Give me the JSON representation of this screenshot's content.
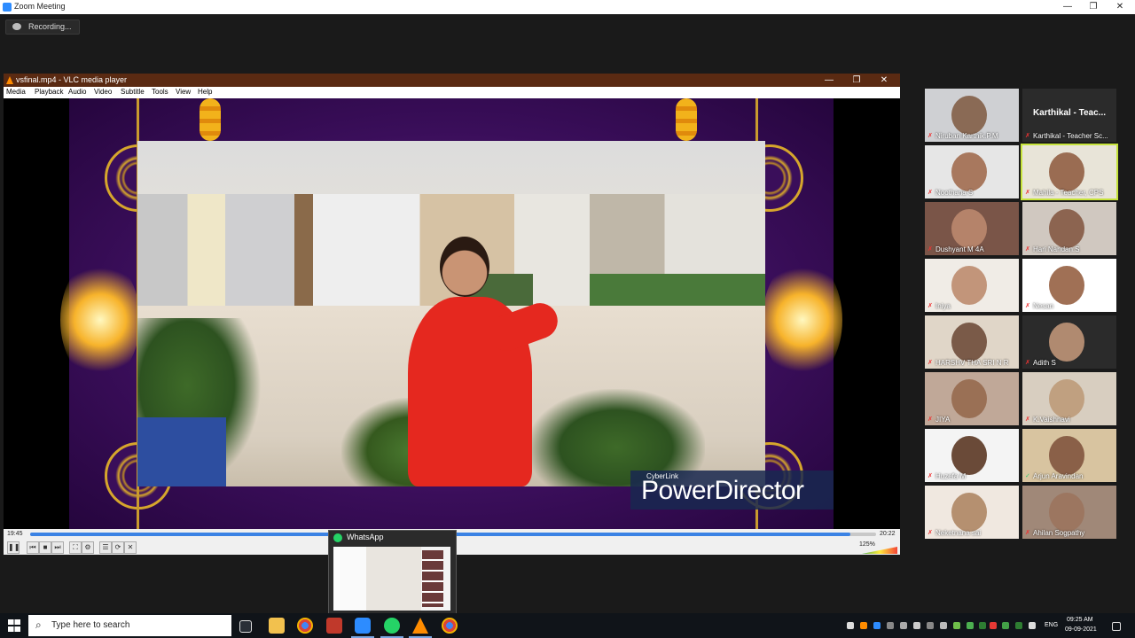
{
  "zoom": {
    "title": "Zoom Meeting",
    "recording_label": "Recording..."
  },
  "vlc": {
    "title": "vsfinal.mp4 - VLC media player",
    "menu": [
      "Media",
      "Playback",
      "Audio",
      "Video",
      "Subtitle",
      "Tools",
      "View",
      "Help"
    ],
    "elapsed": "19:45",
    "total": "20:22",
    "progress": 0.97,
    "volume_label": "125%",
    "watermark_small": "CyberLink",
    "watermark_big": "PowerDirector"
  },
  "participants": [
    {
      "name": "Niruban Karthik.P.M",
      "muted": true
    },
    {
      "name": "Karthikal - Teacher Sc...",
      "muted": true,
      "display_name": "Karthikal - Teac..."
    },
    {
      "name": "Noothana S",
      "muted": true
    },
    {
      "name": "Mahila - Teacher, CPS",
      "muted": true,
      "active_speaker": true
    },
    {
      "name": "Dushyant M 4A",
      "muted": true
    },
    {
      "name": "Hari Nandan.S",
      "muted": true
    },
    {
      "name": "Iniya",
      "muted": true
    },
    {
      "name": "Nesan",
      "muted": true
    },
    {
      "name": "HARSHV THA SRI N R",
      "muted": true
    },
    {
      "name": "Adith S",
      "muted": true
    },
    {
      "name": "JIYA",
      "muted": true
    },
    {
      "name": "K.Vaishnavi",
      "muted": true
    },
    {
      "name": "Huzefa M",
      "muted": true
    },
    {
      "name": "Arjun Aravindan",
      "muted": false
    },
    {
      "name": "Neketnana  sai",
      "muted": true
    },
    {
      "name": "Ahilan Sogpathy",
      "muted": true
    }
  ],
  "whatsapp": {
    "label": "WhatsApp"
  },
  "taskbar": {
    "search_placeholder": "Type here to search",
    "language": "ENG",
    "time": "09:25 AM",
    "date": "09-09-2021"
  },
  "colors": {
    "zoom_blue": "#2d8cff",
    "vlc_orange": "#ff8c00",
    "active_speaker": "#c6e33b",
    "whatsapp_green": "#25d366"
  }
}
